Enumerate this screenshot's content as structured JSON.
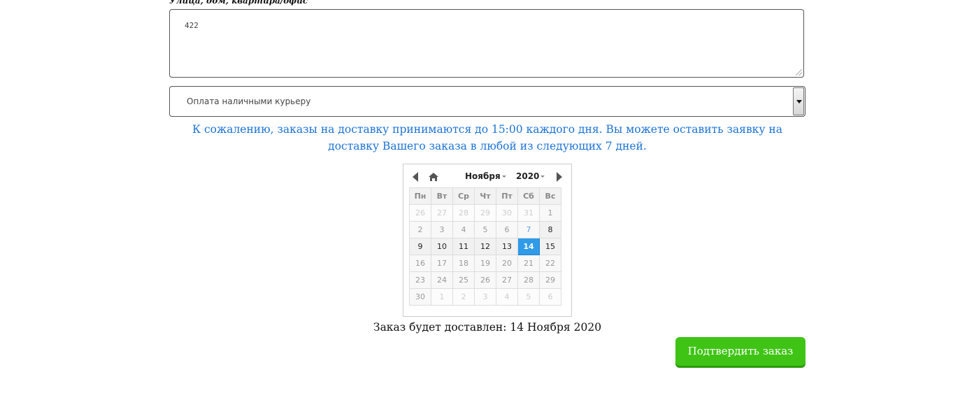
{
  "address": {
    "label": "Улица, дом, квартира/офис",
    "value": "422"
  },
  "payment": {
    "selected": "Оплата наличными курьеру"
  },
  "notice": "К сожалению, заказы на доставку принимаются до 15:00 каждого дня. Вы можете оставить заявку на доставку Вашего заказа в любой из следующих 7 дней.",
  "calendar": {
    "month": "Ноября",
    "year": "2020",
    "weekdays": [
      "Пн",
      "Вт",
      "Ср",
      "Чт",
      "Пт",
      "Сб",
      "Вс"
    ],
    "selected_day": "14",
    "weeks": [
      [
        {
          "d": "26",
          "s": "other"
        },
        {
          "d": "27",
          "s": "other"
        },
        {
          "d": "28",
          "s": "other"
        },
        {
          "d": "29",
          "s": "other"
        },
        {
          "d": "30",
          "s": "other"
        },
        {
          "d": "31",
          "s": "other"
        },
        {
          "d": "1",
          "s": "disabled"
        }
      ],
      [
        {
          "d": "2",
          "s": "disabled"
        },
        {
          "d": "3",
          "s": "disabled"
        },
        {
          "d": "4",
          "s": "disabled"
        },
        {
          "d": "5",
          "s": "disabled"
        },
        {
          "d": "6",
          "s": "disabled"
        },
        {
          "d": "7",
          "s": "today"
        },
        {
          "d": "8",
          "s": "available"
        }
      ],
      [
        {
          "d": "9",
          "s": "available"
        },
        {
          "d": "10",
          "s": "available"
        },
        {
          "d": "11",
          "s": "available"
        },
        {
          "d": "12",
          "s": "available"
        },
        {
          "d": "13",
          "s": "available"
        },
        {
          "d": "14",
          "s": "selected"
        },
        {
          "d": "15",
          "s": "available"
        }
      ],
      [
        {
          "d": "16",
          "s": "disabled"
        },
        {
          "d": "17",
          "s": "disabled"
        },
        {
          "d": "18",
          "s": "disabled"
        },
        {
          "d": "19",
          "s": "disabled"
        },
        {
          "d": "20",
          "s": "disabled"
        },
        {
          "d": "21",
          "s": "disabled"
        },
        {
          "d": "22",
          "s": "disabled"
        }
      ],
      [
        {
          "d": "23",
          "s": "disabled"
        },
        {
          "d": "24",
          "s": "disabled"
        },
        {
          "d": "25",
          "s": "disabled"
        },
        {
          "d": "26",
          "s": "disabled"
        },
        {
          "d": "27",
          "s": "disabled"
        },
        {
          "d": "28",
          "s": "disabled"
        },
        {
          "d": "29",
          "s": "disabled"
        }
      ],
      [
        {
          "d": "30",
          "s": "disabled"
        },
        {
          "d": "1",
          "s": "other"
        },
        {
          "d": "2",
          "s": "other"
        },
        {
          "d": "3",
          "s": "other"
        },
        {
          "d": "4",
          "s": "other"
        },
        {
          "d": "5",
          "s": "other"
        },
        {
          "d": "6",
          "s": "other"
        }
      ]
    ],
    "icons": {
      "prev": "arrow-left-icon",
      "next": "arrow-right-icon",
      "home": "home-icon"
    },
    "colors": {
      "selected": "#2f9be9",
      "today": "#5aa0e6"
    }
  },
  "delivery": {
    "text": "Заказ будет доставлен: 14 Ноября 2020"
  },
  "confirm": {
    "label": "Подтвердить заказ",
    "color": "#3fc416"
  },
  "colors": {
    "notice": "#1a72d6"
  }
}
